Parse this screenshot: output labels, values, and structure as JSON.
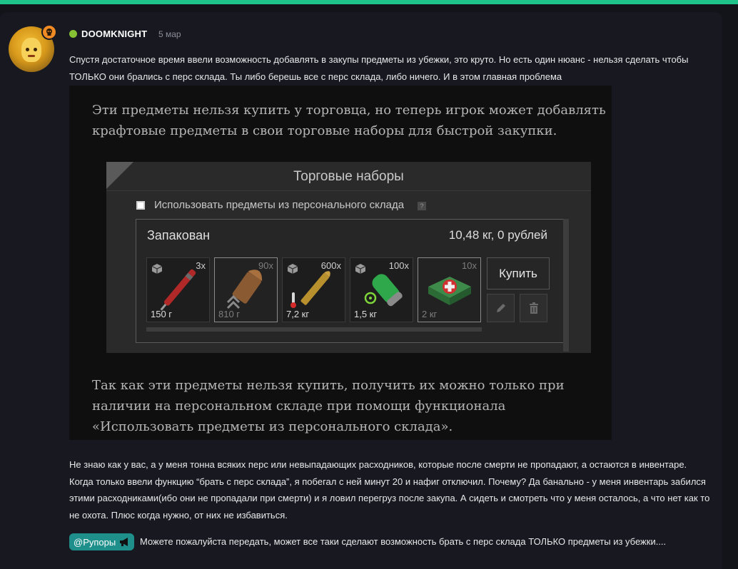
{
  "post": {
    "author": "DOOMKNIGHT",
    "date": "5 мар",
    "paragraph1": "Спустя достаточное время ввели возможность добавлять в закупы предметы из убежки, это круто. Но есть один нюанс - нельзя сделать чтобы ТОЛЬКО они брались с перс склада. Ты либо берешь все с перс склада, либо ничего. И в этом главная проблема",
    "paragraph2": "Не знаю как у вас, а у меня тонна всяких перс или невыпадающих расходников, которые после смерти не пропадают, а остаются в инвентаре. Когда только ввели функцию “брать с перс склада”, я побегал с ней минут 20 и нафиг отключил. Почему? Да банально - у меня инвентарь забился этими расходниками(ибо они не пропадали при смерти) и я ловил перегруз после закупа. А сидеть и смотреть что у меня осталось, а что нет как то не охота. Плюс когда нужно, от них не избавиться.",
    "mention_tag": "@Рупоры",
    "mention_text": "Можете пожалуйста передать, может все таки сделают возможность брать с перс склада ТОЛЬКО предметы из убежки...."
  },
  "quote": {
    "text_top": "Эти предметы нельзя купить у торговца, но теперь игрок может добавлять крафтовые предметы в свои торговые наборы для быстрой закупки.",
    "text_bottom": "Так как эти предметы нельзя купить, получить их можно только при наличии на персональном складе при помощи функционала «Использовать предметы из персонального склада».",
    "panel": {
      "title": "Торговые наборы",
      "checkbox_label": "Использовать предметы из персонального склада",
      "help": "?",
      "set_name": "Запакован",
      "set_weight": "10,48 кг, 0 рублей",
      "buy_label": "Купить",
      "items": [
        {
          "count": "3x",
          "weight": "150 г",
          "icon": "syringe-icon",
          "dim": false
        },
        {
          "count": "90x",
          "weight": "810 г",
          "icon": "bullet-icon",
          "dim": true
        },
        {
          "count": "600x",
          "weight": "7,2 кг",
          "icon": "cartridge-icon",
          "dim": false
        },
        {
          "count": "100x",
          "weight": "1,5 кг",
          "icon": "antidote-icon",
          "dim": false
        },
        {
          "count": "10x",
          "weight": "2 кг",
          "icon": "medkit-icon",
          "dim": true
        }
      ]
    }
  },
  "colors": {
    "accent": "#1fc48a",
    "online": "#86c233",
    "mention": "#1f8f8b",
    "badge": "#f08a24"
  }
}
